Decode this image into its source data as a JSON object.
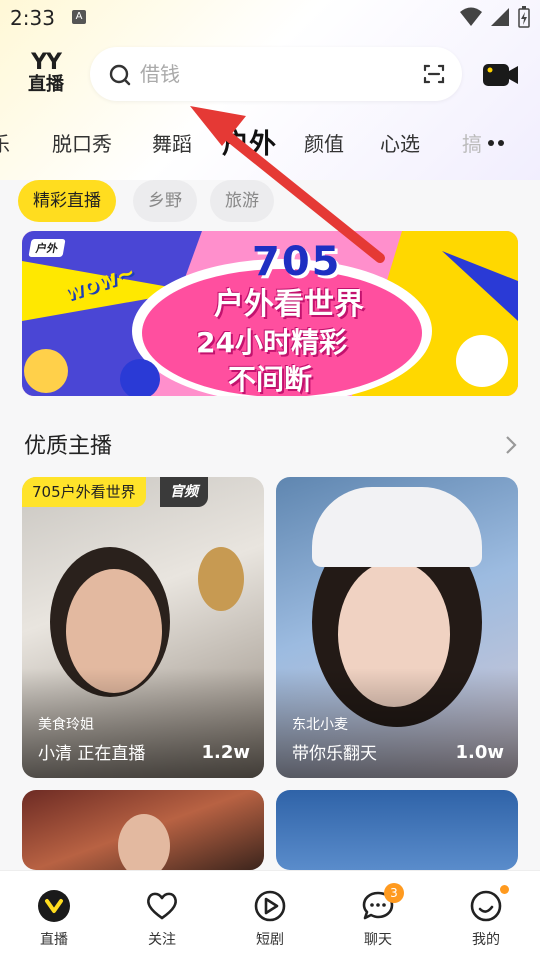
{
  "status_bar": {
    "time": "2:33",
    "notification_icon": "A"
  },
  "header": {
    "logo_top": "YY",
    "logo_bottom": "直播",
    "search_placeholder": "借钱"
  },
  "category_tabs": [
    {
      "label": "乐"
    },
    {
      "label": "脱口秀"
    },
    {
      "label": "舞蹈"
    },
    {
      "label": "户外",
      "active": true
    },
    {
      "label": "颜值"
    },
    {
      "label": "心选"
    },
    {
      "label": "搞"
    }
  ],
  "sub_chips": [
    {
      "label": "精彩直播",
      "active": true
    },
    {
      "label": "乡野"
    },
    {
      "label": "旅游"
    }
  ],
  "banner": {
    "badge": "户外",
    "wow": "wow~",
    "title": "705",
    "line1": "户外看世界",
    "line2": "24小时精彩",
    "line3": "不间断"
  },
  "section": {
    "title": "优质主播"
  },
  "cards": [
    {
      "tag": "705户外看世界",
      "official": "官频",
      "subtitle": "美食玲姐",
      "name": "小清 正在直播",
      "count": "1.2w"
    },
    {
      "subtitle": "东北小麦",
      "name": "带你乐翻天",
      "count": "1.0w"
    }
  ],
  "bottom_nav": [
    {
      "label": "直播",
      "icon": "live-icon",
      "active": true
    },
    {
      "label": "关注",
      "icon": "heart-icon"
    },
    {
      "label": "短剧",
      "icon": "play-icon"
    },
    {
      "label": "聊天",
      "icon": "chat-icon",
      "badge": "3"
    },
    {
      "label": "我的",
      "icon": "profile-icon",
      "dot": true
    }
  ],
  "colors": {
    "accent_yellow": "#ffdd1f",
    "arrow_red": "#e53935",
    "badge_orange": "#ff9a1f"
  }
}
